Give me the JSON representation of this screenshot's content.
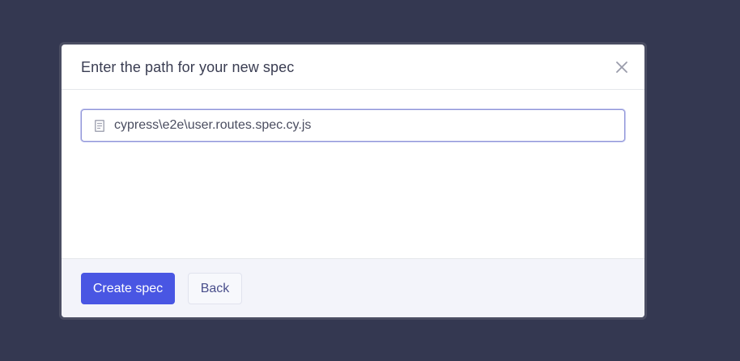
{
  "modal": {
    "title": "Enter the path for your new spec",
    "close_icon": "close-icon"
  },
  "path_input": {
    "icon": "file-icon",
    "value": "cypress\\e2e\\user.routes.spec.cy.js"
  },
  "footer": {
    "create_label": "Create spec",
    "back_label": "Back"
  },
  "colors": {
    "backdrop": "#343851",
    "primary": "#4956e3",
    "footer_bg": "#f3f4fa"
  }
}
